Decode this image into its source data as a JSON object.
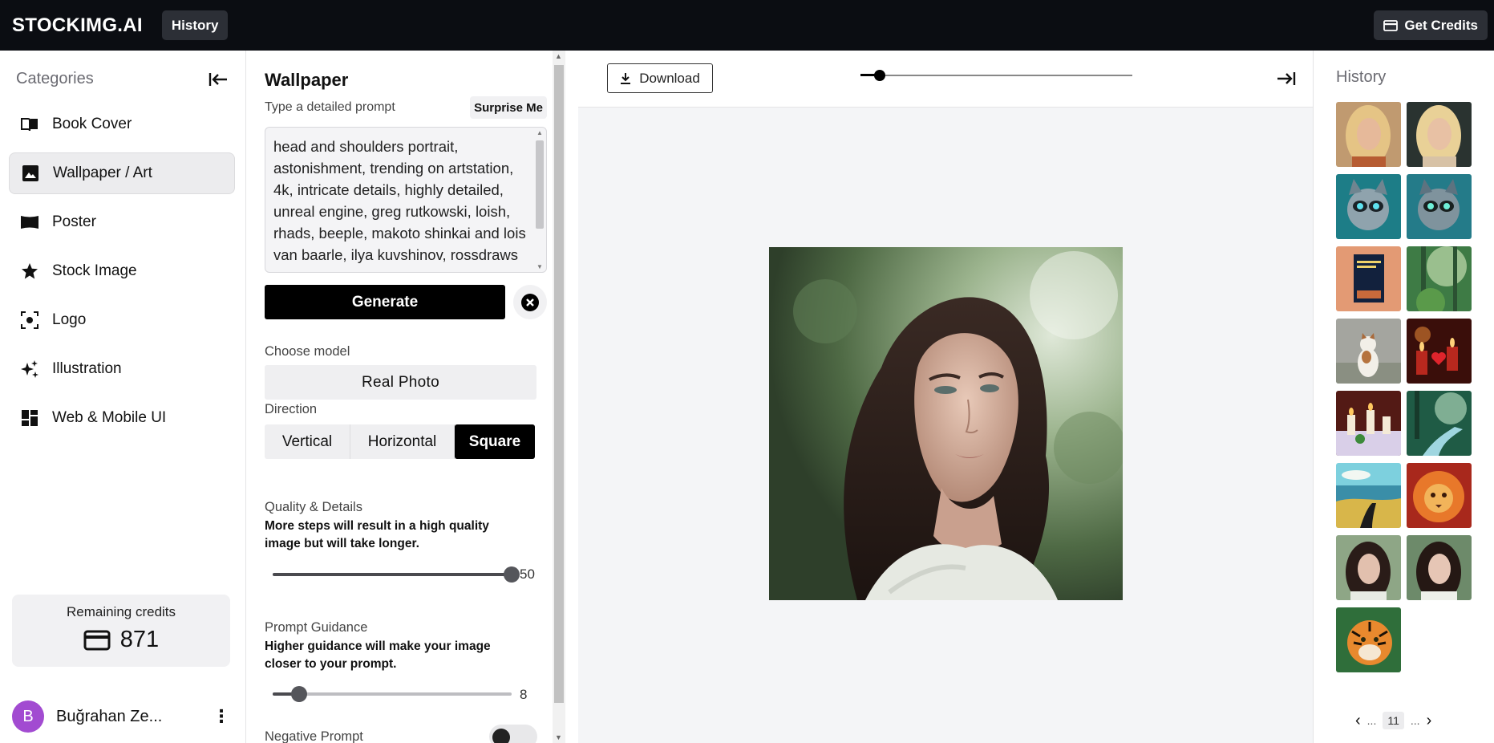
{
  "topbar": {
    "logo": "STOCKIMG.AI",
    "history_label": "History",
    "credits_button": "Get Credits"
  },
  "sidebar": {
    "title": "Categories",
    "items": [
      {
        "label": "Book Cover",
        "icon": "book-icon"
      },
      {
        "label": "Wallpaper / Art",
        "icon": "image-icon",
        "active": true
      },
      {
        "label": "Poster",
        "icon": "poster-icon"
      },
      {
        "label": "Stock Image",
        "icon": "star-icon"
      },
      {
        "label": "Logo",
        "icon": "focus-icon"
      },
      {
        "label": "Illustration",
        "icon": "sparkles-icon"
      },
      {
        "label": "Web & Mobile UI",
        "icon": "dashboard-icon"
      }
    ],
    "credits_label": "Remaining credits",
    "credits_value": "871",
    "user_initial": "B",
    "user_name": "Buğrahan Ze..."
  },
  "panel": {
    "title": "Wallpaper",
    "prompt_label": "Type a detailed prompt",
    "surprise_label": "Surprise Me",
    "prompt_text": "head and shoulders portrait, astonishment, trending on artstation, 4k, intricate details, highly detailed, unreal engine, greg rutkowski, loish, rhads, beeple, makoto shinkai and lois van baarle, ilya kuvshinov, rossdraws",
    "generate_label": "Generate",
    "model_label": "Choose model",
    "model_value": "Real Photo",
    "direction_label": "Direction",
    "directions": [
      "Vertical",
      "Horizontal",
      "Square"
    ],
    "direction_selected": "Square",
    "quality_label": "Quality & Details",
    "quality_desc": "More steps will result in a high quality image but will take longer.",
    "quality_value": "50",
    "quality_fraction": 1.0,
    "guidance_label": "Prompt Guidance",
    "guidance_desc": "Higher guidance will make your image closer to your prompt.",
    "guidance_value": "8",
    "guidance_fraction": 0.11,
    "negative_label": "Negative Prompt",
    "negative_enabled": false
  },
  "main": {
    "download_label": "Download",
    "zoom_fraction": 0.07
  },
  "history": {
    "title": "History",
    "thumbnails": [
      "portrait-blonde",
      "portrait-blonde",
      "raccoon-teal",
      "raccoon-teal",
      "book-cover",
      "forest-green",
      "cat-sitting",
      "candles-red",
      "candles-table",
      "forest-stream",
      "landscape-road",
      "lion-red",
      "portrait-brunette",
      "portrait-brunette",
      "tiger"
    ],
    "pager_prev": "‹",
    "pager_ellipsis_left": "...",
    "pager_current": "11",
    "pager_ellipsis_right": "...",
    "pager_next": "›"
  }
}
